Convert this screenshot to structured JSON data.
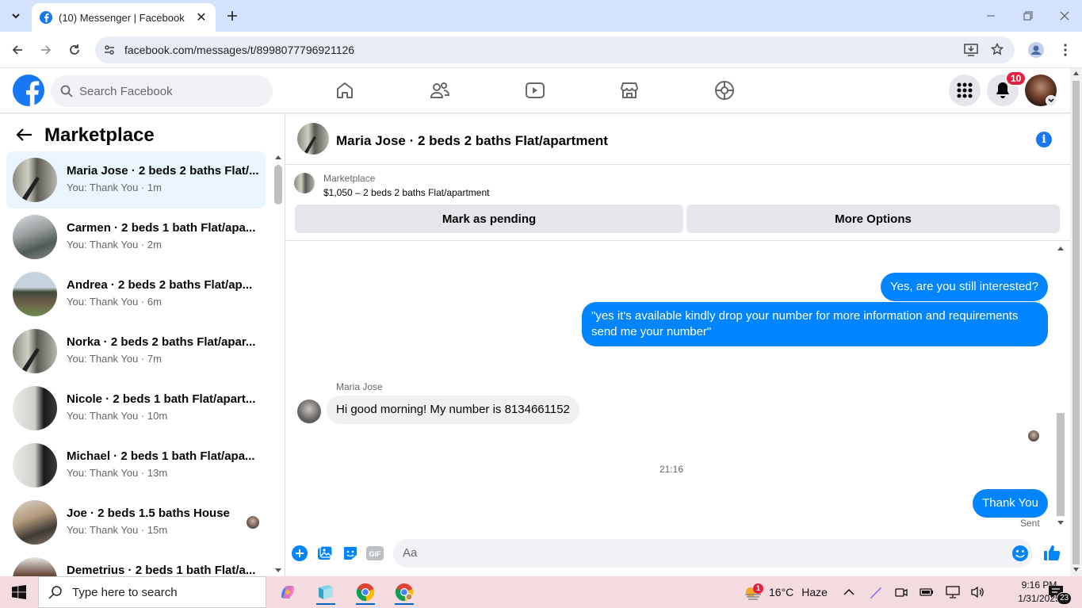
{
  "browser": {
    "tab_title": "(10) Messenger | Facebook",
    "url": "facebook.com/messages/t/8998077796921126"
  },
  "fb": {
    "search_placeholder": "Search Facebook",
    "notification_count": "10"
  },
  "sidebar": {
    "title": "Marketplace",
    "conversations": [
      {
        "name": "Maria Jose · 2 beds 2 baths Flat/...",
        "sub": "You: Thank You · 1m"
      },
      {
        "name": "Carmen · 2 beds 1 bath Flat/apa...",
        "sub": "You: Thank You · 2m"
      },
      {
        "name": "Andrea · 2 beds 2 baths Flat/ap...",
        "sub": "You: Thank You · 6m"
      },
      {
        "name": "Norka · 2 beds 2 baths Flat/apar...",
        "sub": "You: Thank You · 7m"
      },
      {
        "name": "Nicole · 2 beds 1 bath Flat/apart...",
        "sub": "You: Thank You · 10m"
      },
      {
        "name": "Michael · 2 beds 1 bath Flat/apa...",
        "sub": "You: Thank You · 13m"
      },
      {
        "name": "Joe · 2 beds 1.5 baths House",
        "sub": "You: Thank You · 15m"
      },
      {
        "name": "Demetrius · 2 beds 1 bath Flat/a...",
        "sub": ""
      }
    ]
  },
  "chat": {
    "title": "Maria Jose · 2 beds 2 baths Flat/apartment",
    "marketplace_label": "Marketplace",
    "listing": "$1,050 – 2 beds 2 baths Flat/apartment",
    "btn_pending": "Mark as pending",
    "btn_more": "More Options",
    "msg1": "Yes, are you still interested?",
    "msg2": "\"yes it's available kindly drop your number for more information and requirements send me your number\"",
    "sender": "Maria Jose",
    "msg3": "Hi good morning! My number is 8134661152",
    "timestamp": "21:16",
    "msg4": "Thank You",
    "status": "Sent",
    "input_placeholder": "Aa"
  },
  "taskbar": {
    "search_placeholder": "Type here to search",
    "weather_temp": "16°C",
    "weather_desc": "Haze",
    "weather_badge": "1",
    "time": "9:16 PM",
    "date": "1/31/2025",
    "notif_count": "23"
  }
}
